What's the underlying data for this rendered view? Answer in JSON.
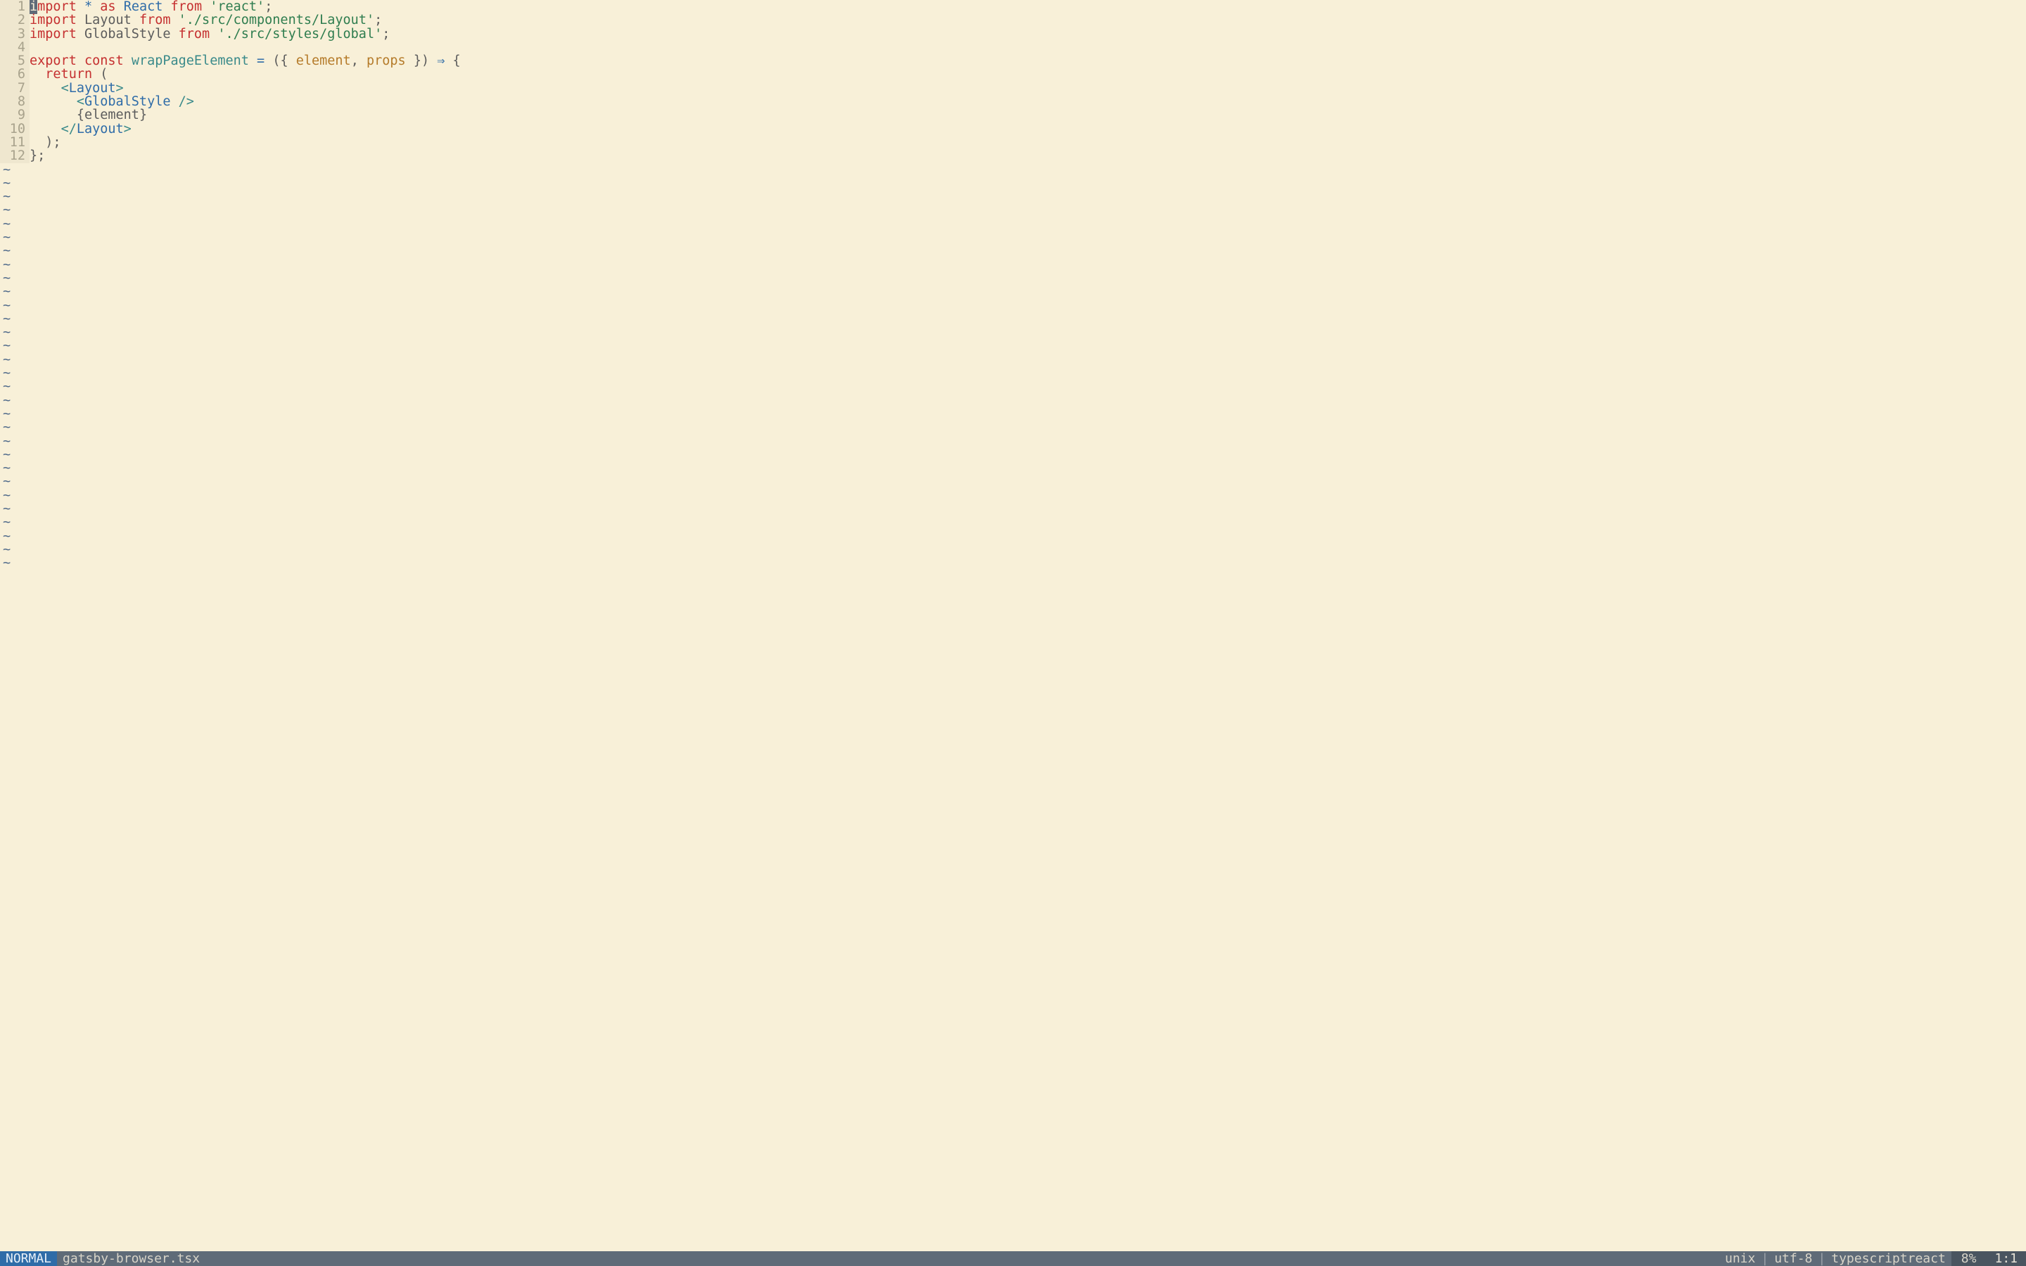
{
  "editor": {
    "lines": [
      {
        "n": "1",
        "tokens": [
          {
            "cls": "cursor-block",
            "t": "i"
          },
          {
            "cls": "kw-red",
            "t": "mport"
          },
          {
            "cls": "",
            "t": " "
          },
          {
            "cls": "kw-blue",
            "t": "*"
          },
          {
            "cls": "",
            "t": " "
          },
          {
            "cls": "kw-red",
            "t": "as"
          },
          {
            "cls": "",
            "t": " "
          },
          {
            "cls": "kw-blue",
            "t": "React"
          },
          {
            "cls": "",
            "t": " "
          },
          {
            "cls": "kw-red",
            "t": "from"
          },
          {
            "cls": "",
            "t": " "
          },
          {
            "cls": "kw-green",
            "t": "'react'"
          },
          {
            "cls": "punct",
            "t": ";"
          }
        ]
      },
      {
        "n": "2",
        "tokens": [
          {
            "cls": "kw-red",
            "t": "import"
          },
          {
            "cls": "",
            "t": " Layout "
          },
          {
            "cls": "kw-red",
            "t": "from"
          },
          {
            "cls": "",
            "t": " "
          },
          {
            "cls": "kw-green",
            "t": "'./src/components/Layout'"
          },
          {
            "cls": "punct",
            "t": ";"
          }
        ]
      },
      {
        "n": "3",
        "tokens": [
          {
            "cls": "kw-red",
            "t": "import"
          },
          {
            "cls": "",
            "t": " GlobalStyle "
          },
          {
            "cls": "kw-red",
            "t": "from"
          },
          {
            "cls": "",
            "t": " "
          },
          {
            "cls": "kw-green",
            "t": "'./src/styles/global'"
          },
          {
            "cls": "punct",
            "t": ";"
          }
        ]
      },
      {
        "n": "4",
        "tokens": []
      },
      {
        "n": "5",
        "tokens": [
          {
            "cls": "kw-red",
            "t": "export"
          },
          {
            "cls": "",
            "t": " "
          },
          {
            "cls": "kw-red",
            "t": "const"
          },
          {
            "cls": "",
            "t": " "
          },
          {
            "cls": "kw-teal",
            "t": "wrapPageElement"
          },
          {
            "cls": "",
            "t": " "
          },
          {
            "cls": "kw-blue",
            "t": "="
          },
          {
            "cls": "",
            "t": " "
          },
          {
            "cls": "punct",
            "t": "({ "
          },
          {
            "cls": "kw-orange",
            "t": "element"
          },
          {
            "cls": "punct",
            "t": ", "
          },
          {
            "cls": "kw-orange",
            "t": "props"
          },
          {
            "cls": "punct",
            "t": " }) "
          },
          {
            "cls": "kw-blue",
            "t": "⇒"
          },
          {
            "cls": "",
            "t": " "
          },
          {
            "cls": "punct",
            "t": "{"
          }
        ]
      },
      {
        "n": "6",
        "tokens": [
          {
            "cls": "",
            "t": "  "
          },
          {
            "cls": "kw-red",
            "t": "return"
          },
          {
            "cls": "",
            "t": " ("
          }
        ]
      },
      {
        "n": "7",
        "tokens": [
          {
            "cls": "",
            "t": "    "
          },
          {
            "cls": "kw-teal",
            "t": "<"
          },
          {
            "cls": "kw-blue",
            "t": "Layout"
          },
          {
            "cls": "kw-teal",
            "t": ">"
          }
        ]
      },
      {
        "n": "8",
        "tokens": [
          {
            "cls": "",
            "t": "      "
          },
          {
            "cls": "kw-teal",
            "t": "<"
          },
          {
            "cls": "kw-blue",
            "t": "GlobalStyle"
          },
          {
            "cls": "",
            "t": " "
          },
          {
            "cls": "kw-teal",
            "t": "/>"
          }
        ]
      },
      {
        "n": "9",
        "tokens": [
          {
            "cls": "",
            "t": "      "
          },
          {
            "cls": "punct",
            "t": "{"
          },
          {
            "cls": "",
            "t": "element"
          },
          {
            "cls": "punct",
            "t": "}"
          }
        ]
      },
      {
        "n": "10",
        "tokens": [
          {
            "cls": "",
            "t": "    "
          },
          {
            "cls": "kw-teal",
            "t": "</"
          },
          {
            "cls": "kw-blue",
            "t": "Layout"
          },
          {
            "cls": "kw-teal",
            "t": ">"
          }
        ]
      },
      {
        "n": "11",
        "tokens": [
          {
            "cls": "",
            "t": "  );"
          }
        ]
      },
      {
        "n": "12",
        "tokens": [
          {
            "cls": "punct",
            "t": "};"
          }
        ]
      }
    ],
    "tilde": "~",
    "tilde_rows": 30
  },
  "status": {
    "mode": "NORMAL",
    "filename": "gatsby-browser.tsx",
    "fileformat": "unix",
    "encoding": "utf-8",
    "filetype": "typescriptreact",
    "percent": "8%",
    "position": "1:1"
  }
}
